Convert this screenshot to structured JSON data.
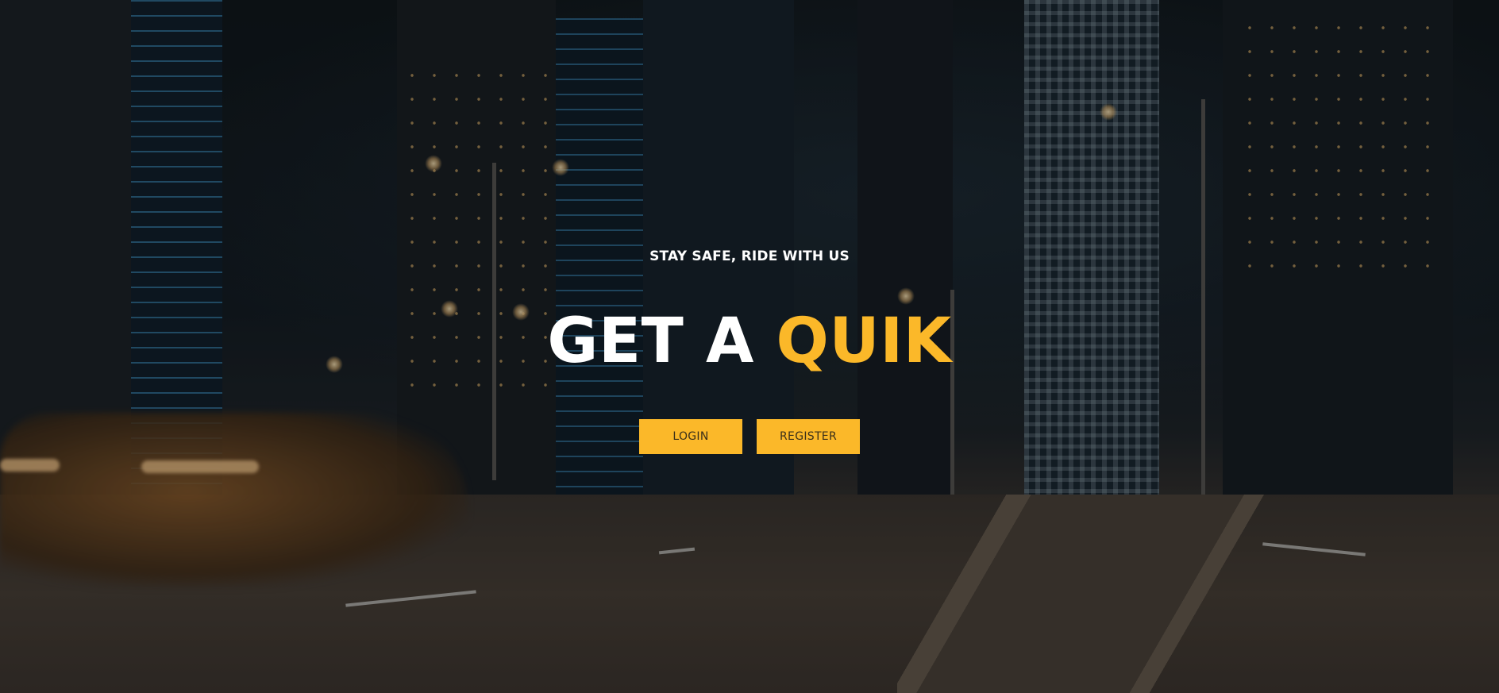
{
  "hero": {
    "tagline": "STAY SAFE, RIDE WITH US",
    "headline_primary": "GET A",
    "headline_accent": "QUIK",
    "accent_color": "#fbb829",
    "buttons": {
      "login_label": "LOGIN",
      "register_label": "REGISTER"
    }
  }
}
